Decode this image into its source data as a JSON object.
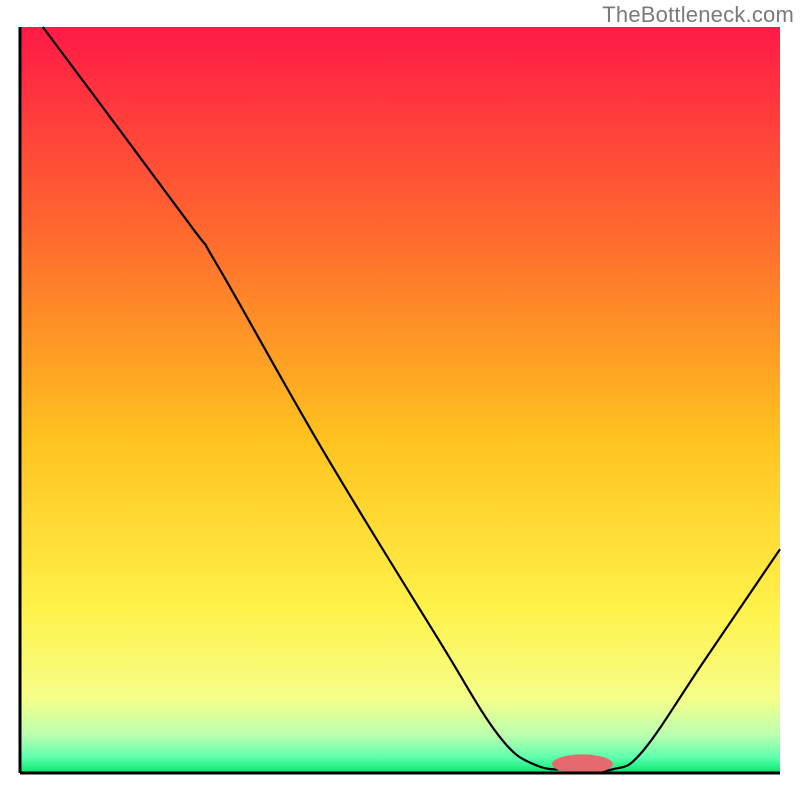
{
  "watermark": "TheBottleneck.com",
  "chart_data": {
    "type": "line",
    "title": "",
    "xlabel": "",
    "ylabel": "",
    "xlim": [
      0,
      100
    ],
    "ylim": [
      0,
      100
    ],
    "background_gradient": {
      "top_color": "#ff1a46",
      "mid_colors": [
        "#ff7a2a",
        "#ffd61e",
        "#feff5c",
        "#d7ff80",
        "#5fff9c"
      ],
      "bottom_color": "#00e86b"
    },
    "curve": [
      {
        "x": 3,
        "y": 100
      },
      {
        "x": 22,
        "y": 74
      },
      {
        "x": 26,
        "y": 68
      },
      {
        "x": 40,
        "y": 43
      },
      {
        "x": 55,
        "y": 18
      },
      {
        "x": 63,
        "y": 5
      },
      {
        "x": 68,
        "y": 1
      },
      {
        "x": 73,
        "y": 0.5
      },
      {
        "x": 78,
        "y": 0.5
      },
      {
        "x": 82,
        "y": 3
      },
      {
        "x": 90,
        "y": 15
      },
      {
        "x": 100,
        "y": 30
      }
    ],
    "marker": {
      "x": 74,
      "y": 1.2,
      "rx": 4,
      "ry": 1.3,
      "color": "#e46a6f"
    },
    "axis_color": "#000000",
    "curve_color": "#000000",
    "curve_width": 2.2
  }
}
